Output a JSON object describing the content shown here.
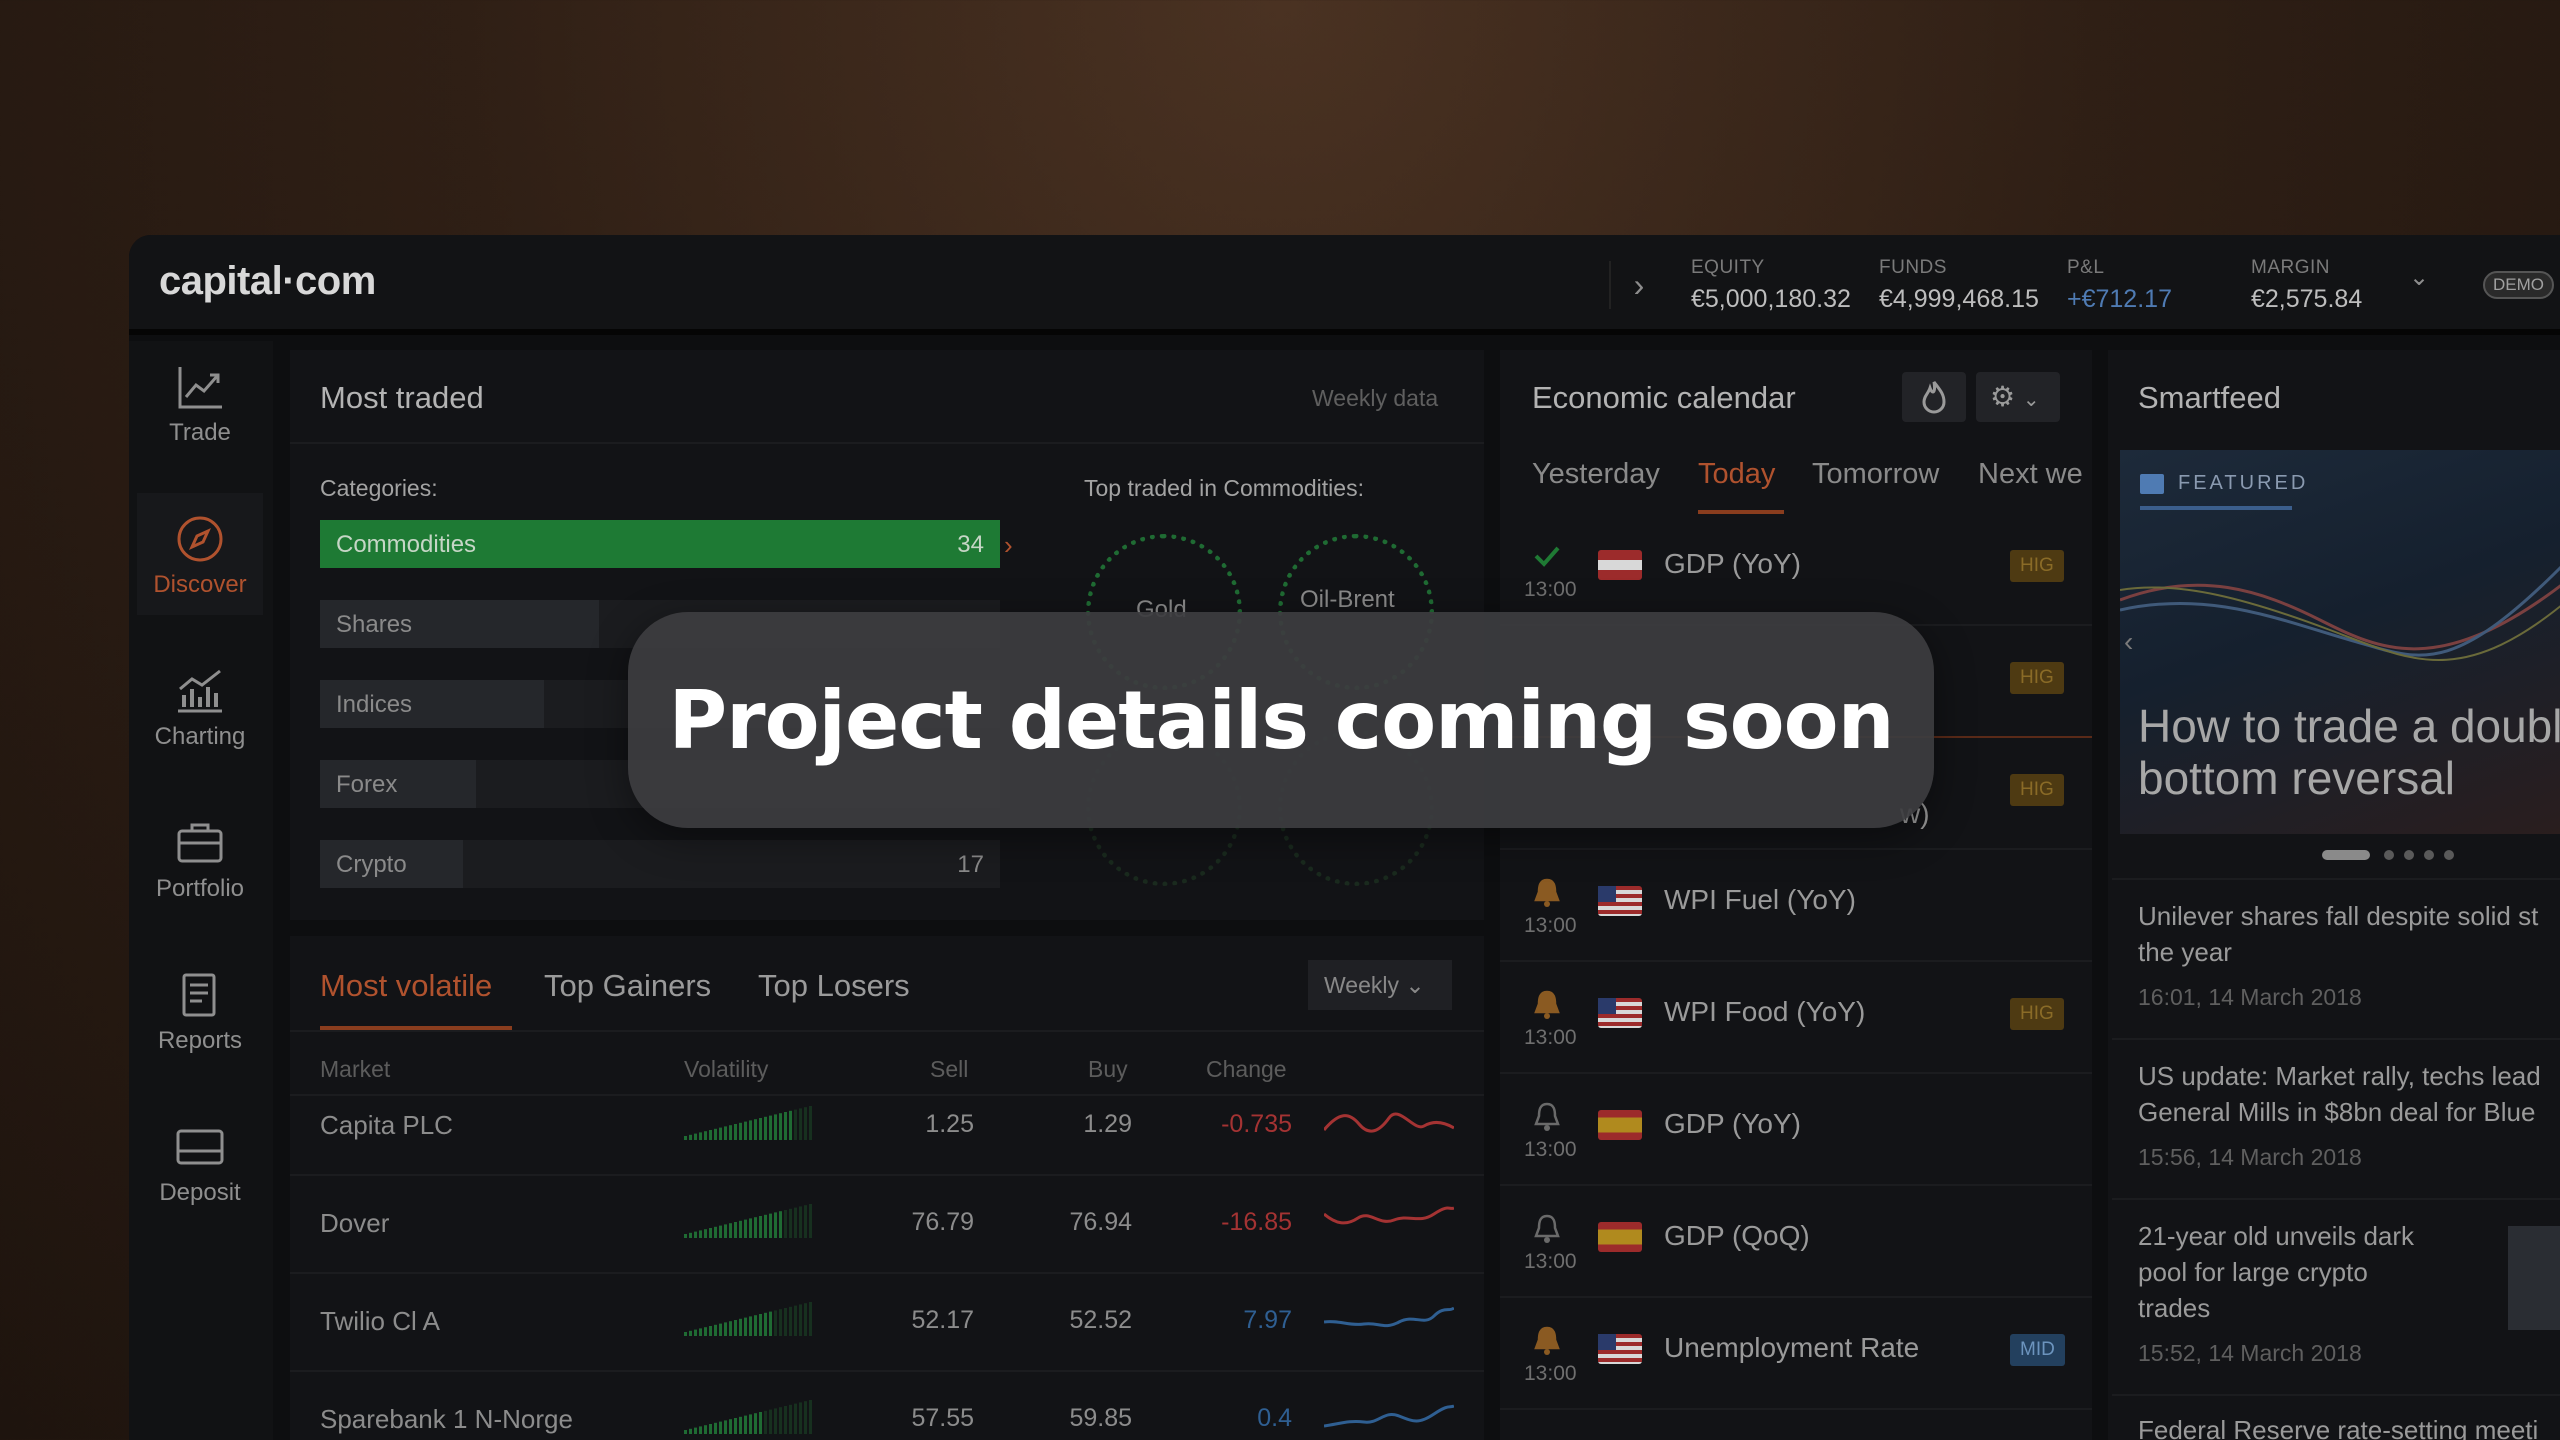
{
  "topbar": {
    "logo": "capital·com",
    "equity_label": "EQUITY",
    "equity_value": "€5,000,180.32",
    "funds_label": "FUNDS",
    "funds_value": "€4,999,468.15",
    "pnl_label": "P&L",
    "pnl_value": "+€712.17",
    "margin_label": "MARGIN",
    "margin_value": "€2,575.84",
    "demo_label": "DEMO"
  },
  "sidebar": {
    "items": [
      {
        "label": "Trade",
        "icon": "chart-up-icon"
      },
      {
        "label": "Discover",
        "icon": "compass-icon"
      },
      {
        "label": "Charting",
        "icon": "bar-chart-icon"
      },
      {
        "label": "Portfolio",
        "icon": "briefcase-icon"
      },
      {
        "label": "Reports",
        "icon": "document-icon"
      },
      {
        "label": "Deposit",
        "icon": "card-icon"
      }
    ]
  },
  "most_traded": {
    "title": "Most traded",
    "subtitle": "Weekly data",
    "categories_label": "Categories:",
    "categories": [
      {
        "name": "Commodities",
        "count": "34",
        "fraction": 1.0
      },
      {
        "name": "Shares",
        "count": "",
        "fraction": 0.41
      },
      {
        "name": "Indices",
        "count": "",
        "fraction": 0.33
      },
      {
        "name": "Forex",
        "count": "",
        "fraction": 0.23
      },
      {
        "name": "Crypto",
        "count": "17",
        "fraction": 0.21
      }
    ],
    "top_traded_label": "Top traded in Commodities:",
    "top_items": [
      "Gold",
      "Oil-Brent"
    ]
  },
  "volatile": {
    "tabs": [
      "Most volatile",
      "Top Gainers",
      "Top Losers"
    ],
    "period": "Weekly",
    "headers": [
      "Market",
      "Volatility",
      "Sell",
      "Buy",
      "Change"
    ],
    "rows": [
      {
        "market": "Capita PLC",
        "sell": "1.25",
        "buy": "1.29",
        "change": "-0.735",
        "dir": "neg"
      },
      {
        "market": "Dover",
        "sell": "76.79",
        "buy": "76.94",
        "change": "-16.85",
        "dir": "neg"
      },
      {
        "market": "Twilio Cl A",
        "sell": "52.17",
        "buy": "52.52",
        "change": "7.97",
        "dir": "pos"
      },
      {
        "market": "Sparebank 1 N-Norge",
        "sell": "57.55",
        "buy": "59.85",
        "change": "0.4",
        "dir": "pos"
      }
    ]
  },
  "calendar": {
    "title": "Economic calendar",
    "tabs": [
      "Yesterday",
      "Today",
      "Tomorrow",
      "Next we"
    ],
    "events": [
      {
        "time": "13:00",
        "name": "GDP (YoY)",
        "badge": "HIG",
        "flag": "at"
      },
      {
        "time": "",
        "name": "",
        "badge": "HIG",
        "flag": ""
      },
      {
        "time": "",
        "name": "",
        "badge": "HIG",
        "flag": ""
      },
      {
        "time": "13:00",
        "name": "WPI Fuel (YoY)",
        "badge": "",
        "flag": "us"
      },
      {
        "time": "13:00",
        "name": "WPI Food (YoY)",
        "badge": "HIG",
        "flag": "us"
      },
      {
        "time": "13:00",
        "name": "GDP (YoY)",
        "badge": "",
        "flag": "es"
      },
      {
        "time": "13:00",
        "name": "GDP (QoQ)",
        "badge": "",
        "flag": "es"
      },
      {
        "time": "13:00",
        "name": "Unemployment Rate",
        "badge": "MID",
        "flag": "us"
      }
    ],
    "partial_text": "w)"
  },
  "smartfeed": {
    "title": "Smartfeed",
    "featured_label": "FEATURED",
    "featured_title_1": "How to trade a doubl",
    "featured_title_2": "bottom reversal",
    "items": [
      {
        "line1": "Unilever shares fall despite solid st",
        "line2": "the year",
        "time": "16:01, 14 March 2018"
      },
      {
        "line1": "US update: Market rally, techs lead",
        "line2": "General Mills in $8bn deal for Blue",
        "time": "15:56, 14 March 2018"
      },
      {
        "line1": "21-year old unveils dark",
        "line2": "pool for large crypto",
        "line3": "trades",
        "time": "15:52, 14 March 2018"
      },
      {
        "line1": "Federal Reserve rate-setting meeti"
      }
    ]
  },
  "overlay": {
    "text": "Project details coming soon"
  },
  "colors": {
    "accent_orange": "#b0522e",
    "commodities_green": "#1e7a34",
    "negative_red": "#a43333",
    "positive_blue": "#2f5f92"
  }
}
